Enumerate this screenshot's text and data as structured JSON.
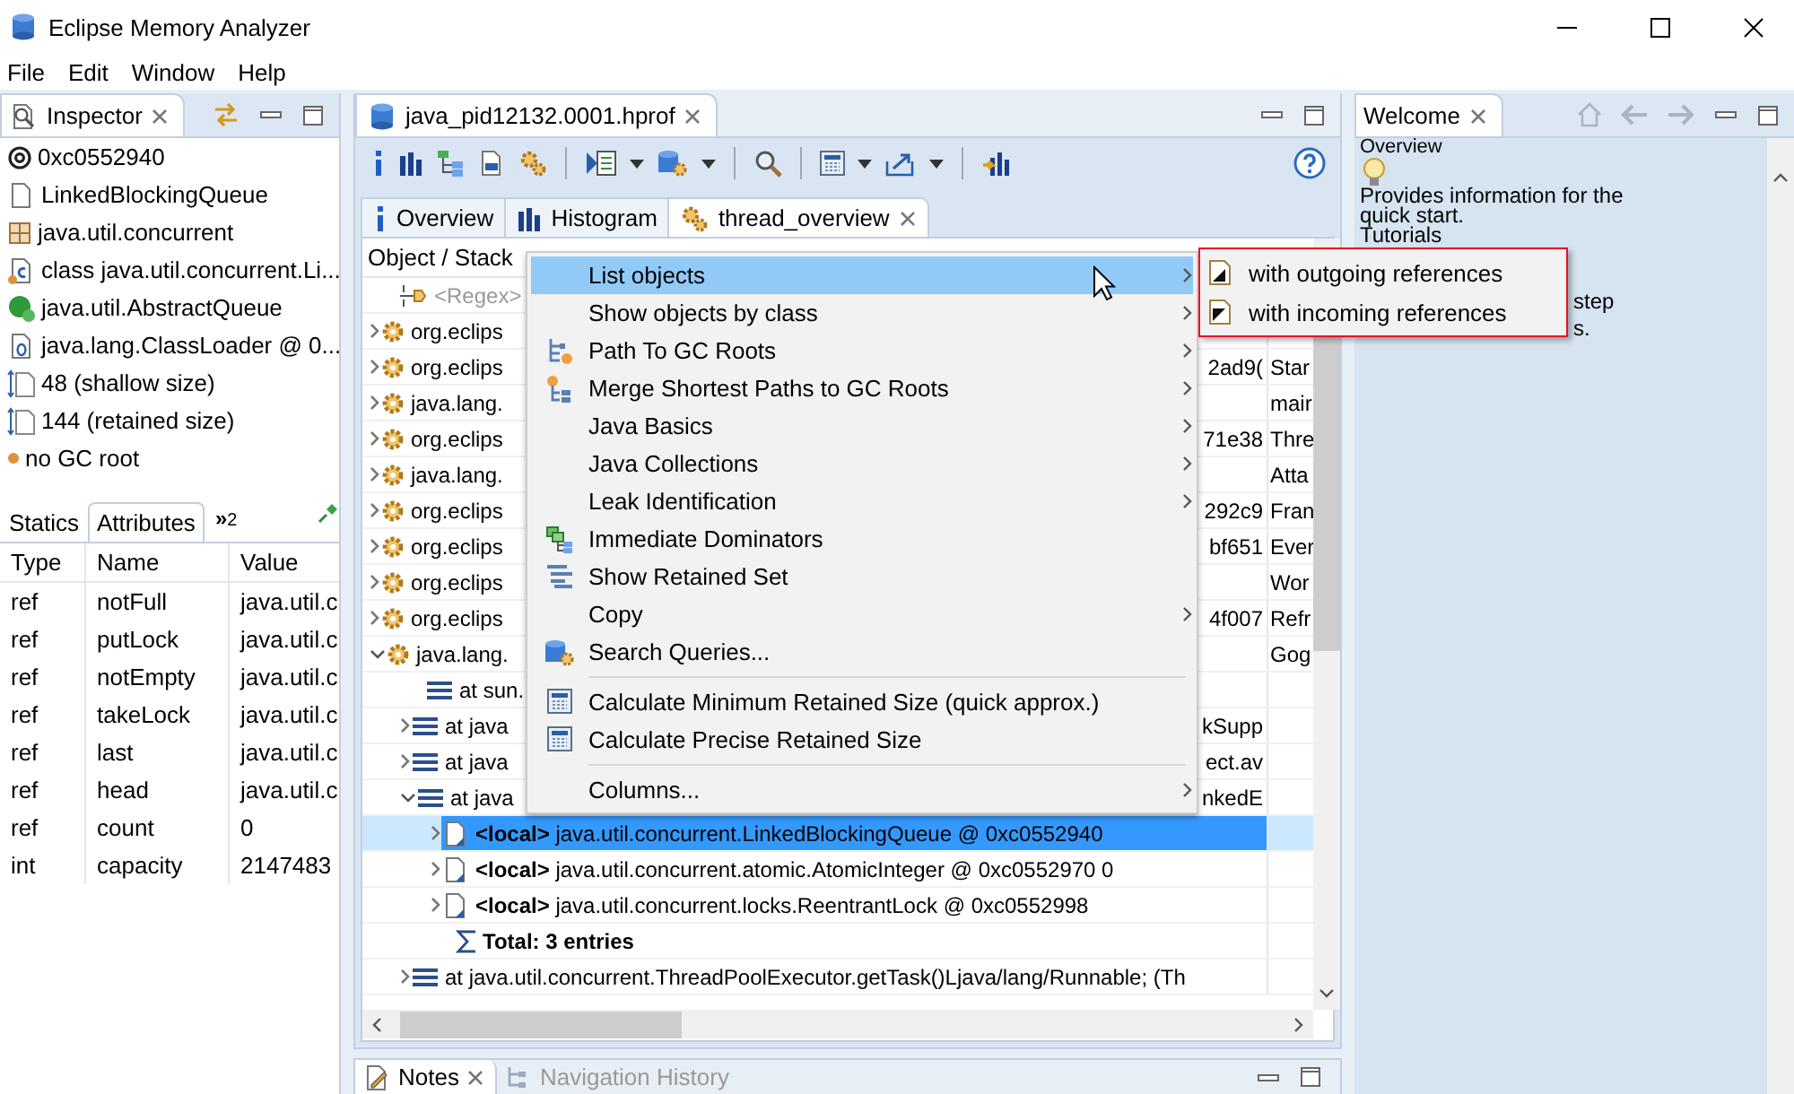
{
  "window": {
    "title": "Eclipse Memory Analyzer"
  },
  "menu_bar": [
    "File",
    "Edit",
    "Window",
    "Help"
  ],
  "inspector": {
    "title": "Inspector",
    "items": [
      {
        "kind": "address",
        "text": "0xc0552940"
      },
      {
        "kind": "object",
        "text": "LinkedBlockingQueue"
      },
      {
        "kind": "package",
        "text": "java.util.concurrent"
      },
      {
        "kind": "class",
        "text": "class java.util.concurrent.Li..."
      },
      {
        "kind": "superclass",
        "text": "java.util.AbstractQueue"
      },
      {
        "kind": "class_loader",
        "text": "java.lang.ClassLoader @ 0..."
      },
      {
        "kind": "size",
        "text": "48 (shallow size)"
      },
      {
        "kind": "size",
        "text": "144 (retained size)"
      },
      {
        "kind": "gc_root",
        "text": "no GC root"
      }
    ],
    "tabs": [
      {
        "label": "Statics",
        "selected": false
      },
      {
        "label": "Attributes",
        "selected": true
      }
    ],
    "more_tabs": {
      "label": "»",
      "count": "2"
    },
    "columns": [
      "Type",
      "Name",
      "Value"
    ],
    "rows": [
      [
        "ref",
        "notFull",
        "java.util.c"
      ],
      [
        "ref",
        "putLock",
        "java.util.c"
      ],
      [
        "ref",
        "notEmpty",
        "java.util.c"
      ],
      [
        "ref",
        "takeLock",
        "java.util.c"
      ],
      [
        "ref",
        "last",
        "java.util.c"
      ],
      [
        "ref",
        "head",
        "java.util.c"
      ],
      [
        "ref",
        "count",
        "0"
      ],
      [
        "int",
        "capacity",
        "2147483"
      ]
    ]
  },
  "editor": {
    "tab": "java_pid12132.0001.hprof",
    "result_tabs": [
      {
        "label": "Overview",
        "kind": "info",
        "selected": false
      },
      {
        "label": "Histogram",
        "kind": "histogram",
        "selected": false
      },
      {
        "label": "thread_overview",
        "kind": "query",
        "selected": true
      }
    ],
    "table": {
      "column_1": "Object / Stack",
      "placeholder": "<Regex>",
      "rows": [
        {
          "kind": "thread",
          "expanded": false,
          "text": "org.eclips"
        },
        {
          "kind": "thread",
          "expanded": false,
          "text": "org.eclips",
          "column_2": "2ad9(",
          "column_3": "Star"
        },
        {
          "kind": "thread",
          "expanded": false,
          "text": "java.lang.",
          "column_3": "mair"
        },
        {
          "kind": "thread",
          "expanded": false,
          "text": "org.eclips",
          "column_2": "71e38",
          "column_3": "Thre"
        },
        {
          "kind": "thread",
          "expanded": false,
          "text": "java.lang.",
          "column_3": "Atta"
        },
        {
          "kind": "thread",
          "expanded": false,
          "text": "org.eclips",
          "column_2": "292c9",
          "column_3": "Fran"
        },
        {
          "kind": "thread",
          "expanded": false,
          "text": "org.eclips",
          "column_2": "bf651",
          "column_3": "Ever"
        },
        {
          "kind": "thread",
          "expanded": false,
          "text": "org.eclips",
          "column_3": "Wor"
        },
        {
          "kind": "thread",
          "expanded": false,
          "text": "org.eclips",
          "column_2": "4f007",
          "column_3": "Refr"
        },
        {
          "kind": "thread",
          "expanded": true,
          "text": "java.lang.",
          "column_3": "Gog",
          "children": [
            {
              "kind": "frame",
              "text": "at sun."
            },
            {
              "kind": "frame",
              "expanded": false,
              "text": "at java",
              "tail": "kSupp"
            },
            {
              "kind": "frame",
              "expanded": false,
              "text": "at java",
              "tail": "ect.av"
            },
            {
              "kind": "frame",
              "expanded": true,
              "text": "at java",
              "tail": "nkedE",
              "children": [
                {
                  "kind": "local",
                  "selected": true,
                  "expanded": false,
                  "label": "<local>",
                  "text": "java.util.concurrent.LinkedBlockingQueue @ 0xc0552940"
                },
                {
                  "kind": "local",
                  "selected": false,
                  "expanded": false,
                  "label": "<local>",
                  "text": "java.util.concurrent.atomic.AtomicInteger @ 0xc0552970  0"
                },
                {
                  "kind": "local",
                  "selected": false,
                  "expanded": false,
                  "label": "<local>",
                  "text": "java.util.concurrent.locks.ReentrantLock @ 0xc0552998"
                },
                {
                  "kind": "total",
                  "selected": false,
                  "text": "Total: 3 entries"
                }
              ]
            },
            {
              "kind": "frame",
              "expanded": false,
              "text": "at java.util.concurrent.ThreadPoolExecutor.getTask()Ljava/lang/Runnable; (Th"
            }
          ]
        }
      ]
    }
  },
  "context_menu": {
    "items": [
      {
        "kind": "plain",
        "label": "List objects",
        "submenu": true,
        "selected": true
      },
      {
        "kind": "plain",
        "label": "Show objects by class",
        "submenu": true,
        "selected": false
      },
      {
        "kind": "path",
        "label": "Path To GC Roots",
        "submenu": true,
        "selected": false
      },
      {
        "kind": "merge",
        "label": "Merge Shortest Paths to GC Roots",
        "submenu": true,
        "selected": false
      },
      {
        "kind": "plain",
        "label": "Java Basics",
        "submenu": true,
        "selected": false
      },
      {
        "kind": "plain",
        "label": "Java Collections",
        "submenu": true,
        "selected": false
      },
      {
        "kind": "plain",
        "label": "Leak Identification",
        "submenu": true,
        "selected": false
      },
      {
        "kind": "dominators",
        "label": "Immediate Dominators",
        "submenu": false,
        "selected": false
      },
      {
        "kind": "retained",
        "label": "Show Retained Set",
        "submenu": false,
        "selected": false
      },
      {
        "kind": "plain",
        "label": "Copy",
        "submenu": true,
        "selected": false
      },
      {
        "kind": "queries",
        "label": "Search Queries...",
        "submenu": false,
        "selected": false
      },
      {
        "kind": "separator"
      },
      {
        "kind": "calculator",
        "label": "Calculate Minimum Retained Size (quick approx.)",
        "submenu": false,
        "selected": false
      },
      {
        "kind": "calculator",
        "label": "Calculate Precise Retained Size",
        "submenu": false,
        "selected": false
      },
      {
        "kind": "separator"
      },
      {
        "kind": "plain",
        "label": "Columns...",
        "submenu": true,
        "selected": false
      }
    ]
  },
  "submenu": {
    "items": [
      {
        "kind": "outgoing",
        "label": "with outgoing references"
      },
      {
        "kind": "incoming",
        "label": "with incoming references"
      }
    ]
  },
  "welcome": {
    "title": "Welcome",
    "heading": "Overview",
    "description": [
      "Provides information for the",
      "quick start."
    ],
    "tutorials": "Tutorials",
    "hidden_lines": [
      "step",
      "s."
    ]
  },
  "bottom_tabs": [
    {
      "label": "Notes",
      "kind": "notes",
      "selected": true
    },
    {
      "label": "Navigation History",
      "kind": "history",
      "selected": false
    }
  ]
}
